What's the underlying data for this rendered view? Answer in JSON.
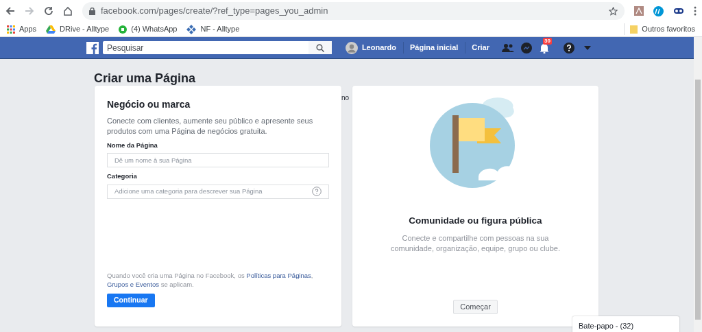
{
  "browser": {
    "url": "facebook.com/pages/create/?ref_type=pages_you_admin",
    "bookmarks": [
      {
        "label": "Apps",
        "kind": "apps"
      },
      {
        "label": "DRive - Alltype",
        "kind": "drive"
      },
      {
        "label": "(4) WhatsApp",
        "kind": "whatsapp"
      },
      {
        "label": "NF - Alltype",
        "kind": "nf"
      }
    ],
    "other_bookmarks": "Outros favoritos"
  },
  "header": {
    "search_placeholder": "Pesquisar",
    "user": "Leonardo",
    "links": [
      "Página inicial",
      "Criar"
    ],
    "notification_count": "30"
  },
  "page_title": "Criar uma Página",
  "business_card": {
    "title": "Negócio ou marca",
    "description": "Conecte com clientes, aumente seu público e apresente seus produtos com uma Página de negócios gratuita.",
    "fields": [
      {
        "label": "Nome da Página",
        "placeholder": "Dê um nome à sua Página",
        "help": false
      },
      {
        "label": "Categoria",
        "placeholder": "Adicione uma categoria para descrever sua Página",
        "help": true
      }
    ],
    "notice": "Quando você cria uma Página no Facebook, os **Políticas para Páginas**, **Grupos e Eventos** se aplicam.",
    "button": "Continuar"
  },
  "partial_text": "no",
  "community_card": {
    "title": "Comunidade ou figura pública",
    "description": "Conecte e compartilhe com pessoas na sua comunidade, organização, equipe, grupo ou clube.",
    "button": "Começar"
  },
  "chat": {
    "label": "Bate-papo - (32)"
  }
}
